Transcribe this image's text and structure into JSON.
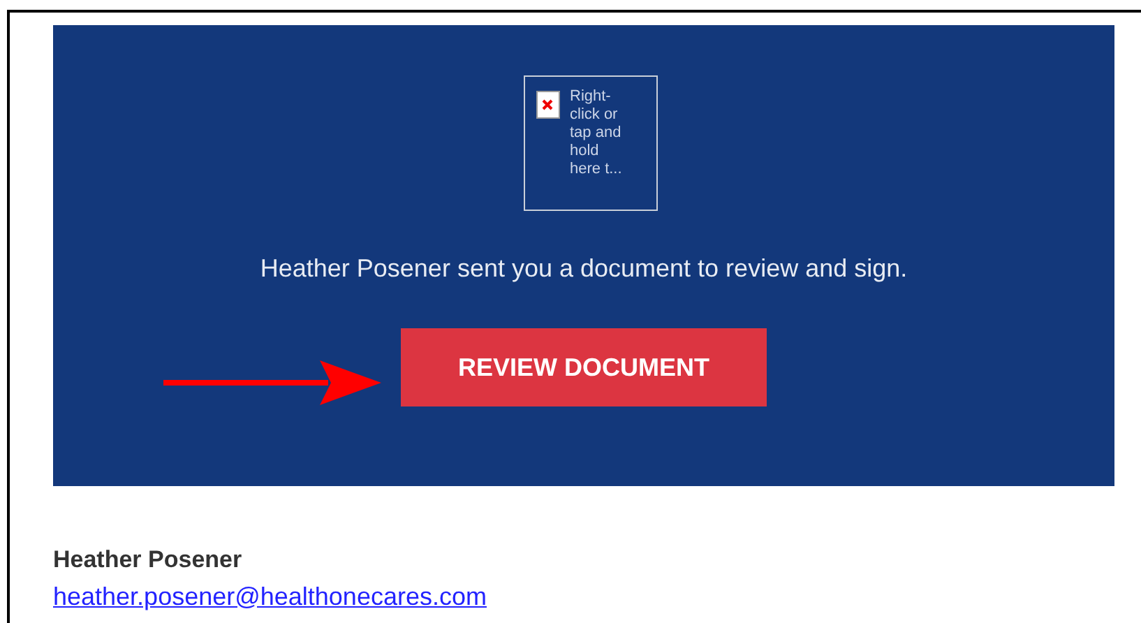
{
  "image_placeholder": {
    "alt_text": "Right-click or tap and hold here t..."
  },
  "message": "Heather Posener sent you a document to review and sign.",
  "review_button": "REVIEW DOCUMENT",
  "sender": {
    "name": "Heather Posener",
    "email": "heather.posener@healthonecares.com"
  }
}
